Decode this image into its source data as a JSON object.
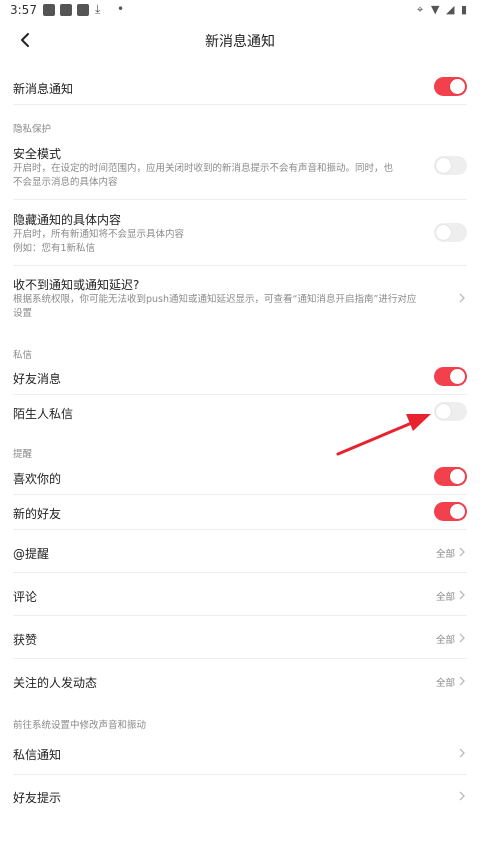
{
  "status_bar": {
    "time": "3:57",
    "icons": [
      "notification-icon",
      "notification-icon",
      "notification-icon",
      "download-icon",
      "dot-icon",
      "location-icon",
      "wifi-icon",
      "signal-icon",
      "battery-icon"
    ]
  },
  "header": {
    "title": "新消息通知",
    "back_icon": "chevron-left-icon"
  },
  "main_toggle": {
    "label": "新消息通知",
    "enabled": true
  },
  "privacy": {
    "section_title": "隐私保护",
    "safe_mode": {
      "label": "安全模式",
      "desc_line1": "开启时，在设定的时间范围内，应用关闭时收到的新消息提示不会有声音和振动。同时，也",
      "desc_line2": "不会显示消息的具体内容",
      "enabled": false
    },
    "hide_content": {
      "label": "隐藏通知的具体内容",
      "desc_line1": "开启时，所有新通知将不会显示具体内容",
      "desc_line2": "例如：您有1新私信",
      "enabled": false
    },
    "no_notify": {
      "label": "收不到通知或通知延迟?",
      "desc_line1": "根据系统权限，你可能无法收到push通知或通知延迟显示，可查看“通知消息开启指南”进行对应",
      "desc_line2": "设置"
    }
  },
  "dm": {
    "section_title": "私信",
    "friend_messages": {
      "label": "好友消息",
      "enabled": true
    },
    "stranger_messages": {
      "label": "陌生人私信",
      "enabled": false
    }
  },
  "reminders": {
    "section_title": "提醒",
    "likes_you": {
      "label": "喜欢你的",
      "enabled": true
    },
    "new_friends": {
      "label": "新的好友",
      "enabled": true
    },
    "mentions": {
      "label": "@提醒",
      "value": "全部"
    },
    "comments": {
      "label": "评论",
      "value": "全部"
    },
    "likes_received": {
      "label": "获赞",
      "value": "全部"
    },
    "following_updates": {
      "label": "关注的人发动态",
      "value": "全部"
    }
  },
  "system": {
    "section_title": "前往系统设置中修改声音和振动",
    "dm_notification": {
      "label": "私信通知"
    },
    "friend_alerts": {
      "label": "好友提示"
    }
  },
  "colors": {
    "accent": "#f2404c",
    "toggle_off": "#eeeeee",
    "secondary_text": "#8a8a8a",
    "divider": "#eeeeee",
    "annotation_arrow": "#e8232f"
  }
}
